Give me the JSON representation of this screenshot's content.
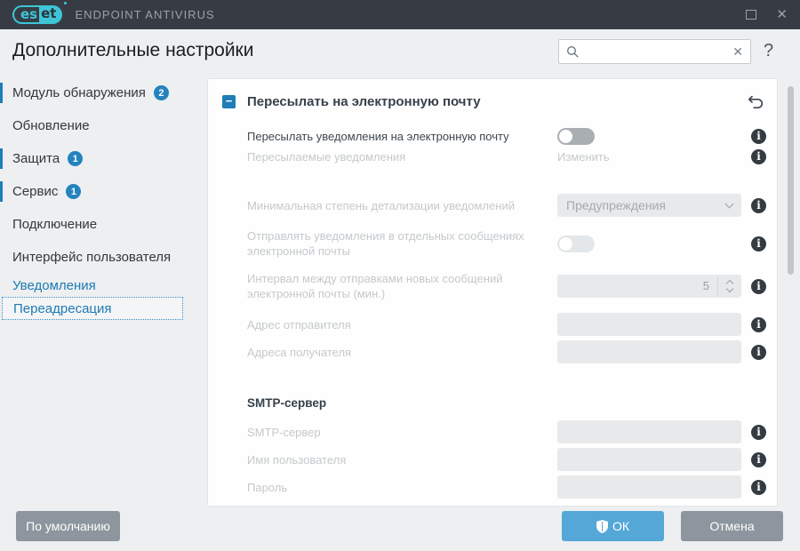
{
  "titlebar": {
    "brand_es": "es",
    "brand_et": "et",
    "product": "ENDPOINT ANTIVIRUS",
    "close_icon": "✕"
  },
  "header": {
    "title": "Дополнительные настройки",
    "search_value": "",
    "clear_icon": "✕",
    "help_icon": "?"
  },
  "sidebar": {
    "items": [
      {
        "label": "Модуль обнаружения",
        "badge": "2"
      },
      {
        "label": "Обновление"
      },
      {
        "label": "Защита",
        "badge": "1"
      },
      {
        "label": "Сервис",
        "badge": "1"
      },
      {
        "label": "Подключение"
      },
      {
        "label": "Интерфейс пользователя"
      },
      {
        "label": "Уведомления"
      },
      {
        "label": "Переадресация"
      }
    ]
  },
  "main": {
    "section_title": "Пересылать на электронную почту",
    "collapse_icon": "−",
    "info_icon": "i",
    "rows": {
      "forward": {
        "label": "Пересылать уведомления на электронную почту",
        "toggle": "off"
      },
      "forwarded": {
        "label": "Пересылаемые уведомления",
        "action": "Изменить"
      },
      "verbosity": {
        "label": "Минимальная степень детализации уведомлений",
        "value": "Предупреждения"
      },
      "separate": {
        "label": "Отправлять уведомления в отдельных сообщениях электронной почты",
        "toggle": "off"
      },
      "interval": {
        "label": "Интервал между отправками новых сообщений электронной почты (мин.)",
        "value": "5"
      },
      "sender": {
        "label": "Адрес отправителя",
        "value": ""
      },
      "recipients": {
        "label": "Адреса получателя",
        "value": ""
      }
    },
    "smtp": {
      "heading": "SMTP-сервер",
      "server": {
        "label": "SMTP-сервер",
        "value": ""
      },
      "username": {
        "label": "Имя пользователя",
        "value": ""
      },
      "password": {
        "label": "Пароль",
        "value": ""
      }
    }
  },
  "footer": {
    "default_label": "По умолчанию",
    "ok_label": "ОК",
    "cancel_label": "Отмена"
  },
  "colors": {
    "accent_blue": "#1f7db8",
    "badge_blue": "#2483bd",
    "ok_button": "#54a7d7",
    "gray_button": "#8d969e",
    "titlebar_bg": "#373c44",
    "logo_teal": "#3ec6d8",
    "window_bg": "#edeff1",
    "disabled_text": "#c5c9cc"
  }
}
